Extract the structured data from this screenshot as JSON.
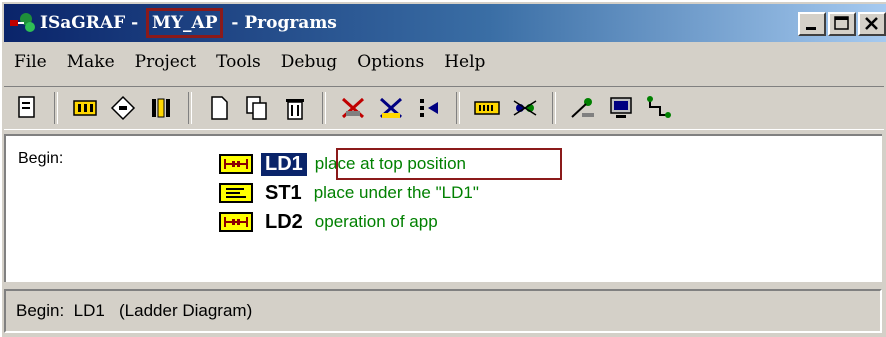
{
  "window": {
    "title_prefix": "ISaGRAF - ",
    "title_project": "MY_AP",
    "title_suffix": " - Programs",
    "controls": [
      "_",
      "□",
      "×"
    ]
  },
  "menu": {
    "items": [
      "File",
      "Make",
      "Project",
      "Tools",
      "Debug",
      "Options",
      "Help"
    ]
  },
  "toolbar": {
    "buttons": [
      "properties-icon",
      "dictionary-icon",
      "link-icon",
      "io-connection-icon",
      "new-program-icon",
      "copy-icon",
      "delete-icon",
      "make-icon",
      "verify-icon",
      "step-icon",
      "simulate-icon",
      "debug-icon",
      "download-icon",
      "monitor-icon",
      "connect-icon"
    ]
  },
  "programs": {
    "section_label": "Begin:",
    "items": [
      {
        "name": "LD1",
        "desc": "place at top position",
        "type_icon": "ladder-diagram-icon",
        "selected": true
      },
      {
        "name": "ST1",
        "desc": "place under the \"LD1\"",
        "type_icon": "structured-text-icon",
        "selected": false
      },
      {
        "name": "LD2",
        "desc": "operation of app",
        "type_icon": "ladder-diagram-icon",
        "selected": false
      }
    ]
  },
  "status": {
    "text": "Begin:  LD1   (Ladder Diagram)"
  }
}
